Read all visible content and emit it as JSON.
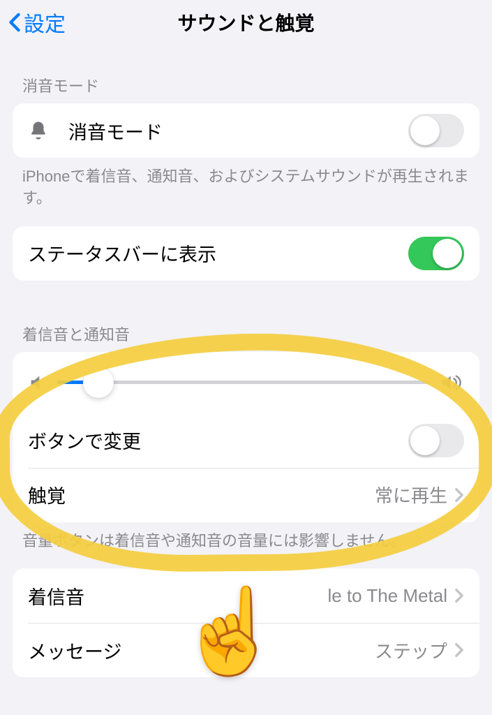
{
  "nav": {
    "back_label": "設定",
    "title": "サウンドと触覚"
  },
  "silent": {
    "header": "消音モード",
    "label": "消音モード",
    "enabled": false,
    "footer": "iPhoneで着信音、通知音、およびシステムサウンドが再生されます。"
  },
  "status_bar": {
    "label": "ステータスバーに表示",
    "enabled": true
  },
  "ringer": {
    "header": "着信音と通知音",
    "volume_percent": 11,
    "change_with_buttons_label": "ボタンで変更",
    "change_with_buttons_enabled": false,
    "haptics_label": "触覚",
    "haptics_value": "常に再生",
    "footer": "音量ボタンは着信音や通知音の音量には影響しません。"
  },
  "sounds": {
    "ringtone_label": "着信音",
    "ringtone_value": "le to The Metal",
    "message_label": "メッセージ",
    "message_value": "ステップ"
  }
}
